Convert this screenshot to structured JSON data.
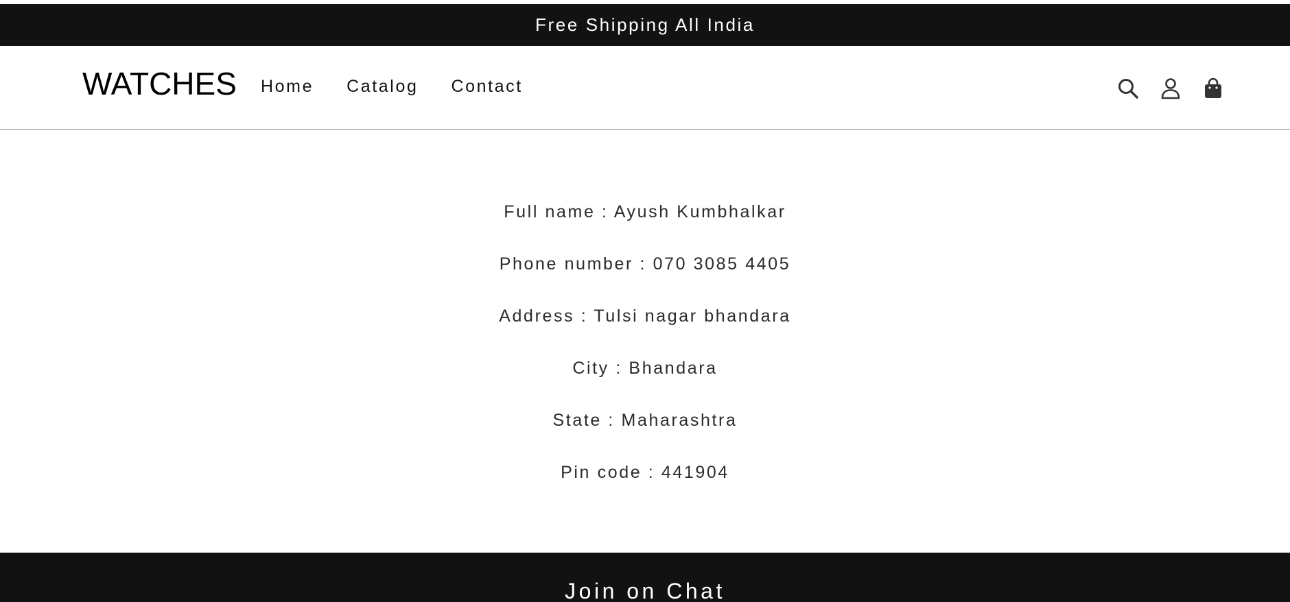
{
  "announcement": {
    "text": "Free Shipping All India"
  },
  "header": {
    "logo": "WATCHES",
    "nav": [
      {
        "label": "Home"
      },
      {
        "label": "Catalog"
      },
      {
        "label": "Contact"
      }
    ],
    "icons": [
      "search-icon",
      "account-icon",
      "cart-icon"
    ]
  },
  "details": {
    "full_name": "Full name : Ayush Kumbhalkar",
    "phone": "Phone number : 070 3085 4405",
    "address": "Address : Tulsi nagar bhandara",
    "city": "City : Bhandara",
    "state": "State : Maharashtra",
    "pin": "Pin code : 441904"
  },
  "footer": {
    "title": "Join on Chat"
  },
  "colors": {
    "bar": "#121212",
    "text": "#2b2b2b",
    "background": "#ffffff"
  }
}
